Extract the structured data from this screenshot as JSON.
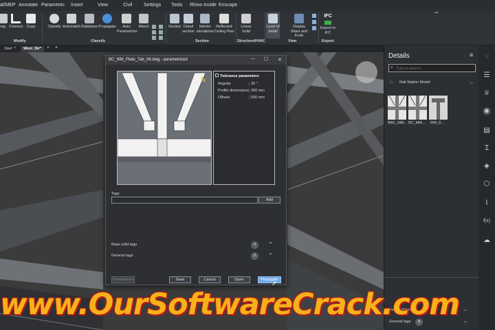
{
  "menu": {
    "items": [
      "al/MEP",
      "Annotate",
      "Parametric",
      "Insert",
      "View",
      "Civil",
      "Settings",
      "Tools",
      "Rhino Inside",
      "Enscape"
    ]
  },
  "ribbon": {
    "modify_tools": [
      "rag",
      "Connect",
      "Copy"
    ],
    "classify_tools": [
      "Classify",
      "Automatch",
      "Database",
      "Propagate",
      "Auto Parametrize",
      "Attach"
    ],
    "section_tools": [
      "Section",
      "Detail section",
      "Interior elevations",
      "Reflected Ceiling Plan"
    ],
    "structure_tools": [
      "Linear Solid"
    ],
    "view_tools": [
      "Level of detail",
      "Display Sides and Ends"
    ],
    "export_tools": [
      "Export to IFC"
    ],
    "ifc_badge": "IFC",
    "groups": [
      "Modify",
      "Classify",
      "Section",
      "Structure/HVAC",
      "View",
      "Export"
    ],
    "overflow": "•••"
  },
  "tabs": {
    "items": [
      "Start",
      "West_Str*"
    ],
    "close": "×",
    "add": "+"
  },
  "dialog": {
    "title": "BC_MM_Plate_Tab_06.dwg  -  parametrized",
    "minimize": "—",
    "maximize": "☐",
    "close": "✕",
    "tolerance": {
      "heading": "Tolerance parameters",
      "rows": [
        {
          "name": "Angular",
          "value": "30 °"
        },
        {
          "name": "Profile dimensions",
          "value": "300 mm"
        },
        {
          "name": "Offsets",
          "value": "500 mm"
        }
      ]
    },
    "tags_label": "Tags",
    "tags_value": "",
    "add_label": "Add",
    "sections": [
      {
        "label": "Base solid tags",
        "count": "4"
      },
      {
        "label": "General tags",
        "count": "8"
      }
    ],
    "buttons": {
      "parametrize": "Parametrize",
      "save": "Save",
      "cancel": "Cancel",
      "open": "Open",
      "propagate": "Propagate"
    }
  },
  "details": {
    "title": "Details",
    "search_placeholder": "Type to search",
    "breadcrumb": "Rail Station Model",
    "thumbnails": [
      "BBC_MM...",
      "BC_MM...",
      "RW_0..."
    ],
    "tag_rows": [
      {
        "label": "Base solid tags"
      },
      {
        "label": "General tags"
      }
    ]
  },
  "rightbar": {
    "icons": [
      "lightbulb-icon",
      "sliders-icon",
      "trophy-icon",
      "target-icon",
      "library-icon",
      "beam-icon",
      "layers-icon",
      "cube-icon",
      "clip-icon",
      "function-icon",
      "cloud-icon"
    ],
    "function_label": "f(x)"
  },
  "watermark": "www.OurSoftwareCrack.com",
  "colors": {
    "accent": "#4a90d9",
    "propagate": "#6fa8e8",
    "watermark": "#f5b21a"
  }
}
